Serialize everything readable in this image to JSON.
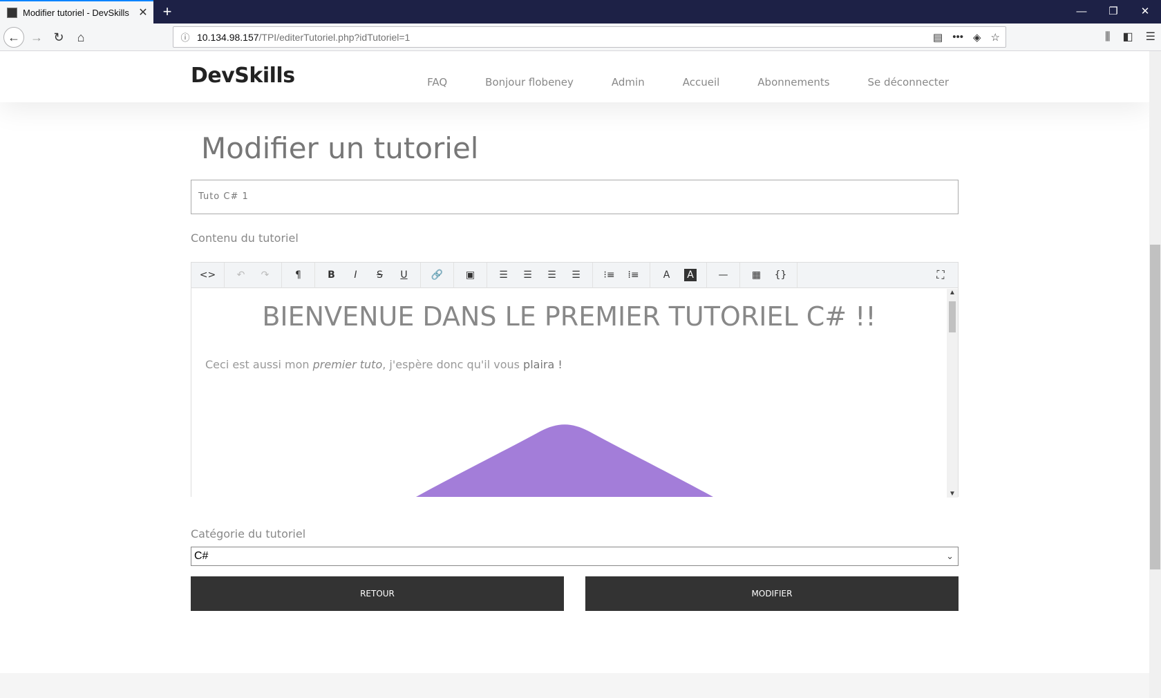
{
  "browser": {
    "tab_title": "Modifier tutoriel - DevSkills",
    "url_host": "10.134.98.157",
    "url_path": "/TPI/editerTutoriel.php?idTutoriel=1"
  },
  "site": {
    "logo": "DevSkills",
    "menu": [
      "FAQ",
      "Bonjour flobeney",
      "Admin",
      "Accueil",
      "Abonnements",
      "Se déconnecter"
    ]
  },
  "form": {
    "page_title": "Modifier un tutoriel",
    "title_value": "Tuto C# 1",
    "content_label": "Contenu du tutoriel",
    "category_label": "Catégorie du tutoriel",
    "category_value": "C#",
    "back_button": "RETOUR",
    "submit_button": "MODIFIER"
  },
  "editor": {
    "heading": "BIENVENUE DANS LE PREMIER TUTORIEL C# !!",
    "para_1": "Ceci est aussi mon ",
    "para_em": "premier tuto",
    "para_2": ", j'espère donc qu'il vous ",
    "para_b": "plaira !",
    "image_color": "#9b72d6"
  }
}
